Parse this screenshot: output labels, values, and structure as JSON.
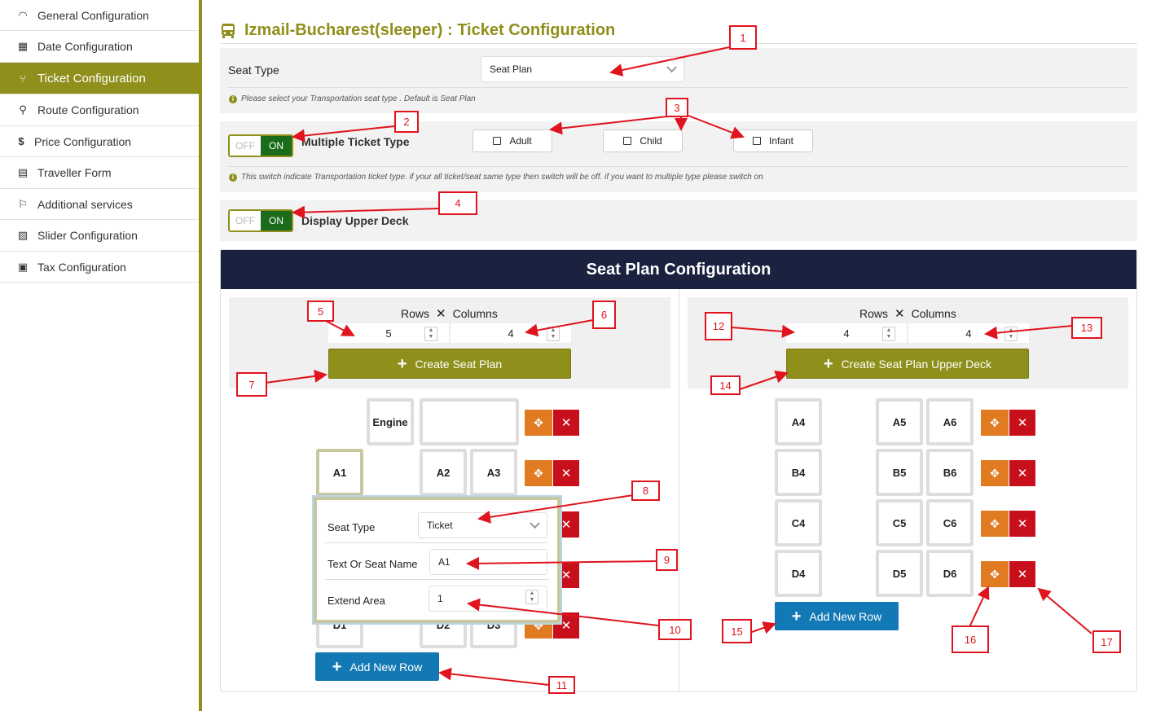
{
  "sidebar": {
    "items": [
      {
        "label": "General Configuration",
        "icon": "rainbow-icon"
      },
      {
        "label": "Date Configuration",
        "icon": "calendar-icon"
      },
      {
        "label": "Ticket Configuration",
        "icon": "seat-icon",
        "active": true
      },
      {
        "label": "Route Configuration",
        "icon": "route-icon"
      },
      {
        "label": "Price Configuration",
        "icon": "dollar-icon"
      },
      {
        "label": "Traveller Form",
        "icon": "form-icon"
      },
      {
        "label": "Additional services",
        "icon": "hand-service-icon"
      },
      {
        "label": "Slider Configuration",
        "icon": "images-icon"
      },
      {
        "label": "Tax Configuration",
        "icon": "money-icon"
      }
    ]
  },
  "header": {
    "title": "Izmail-Bucharest(sleeper) : Ticket Configuration"
  },
  "seat_type": {
    "label": "Seat Type",
    "value": "Seat Plan",
    "hint": "Please select your Transportation seat type . Default is Seat Plan"
  },
  "multiple_ticket": {
    "off": "OFF",
    "on": "ON",
    "label": "Multiple Ticket Type",
    "options": [
      "Adult",
      "Child",
      "Infant"
    ],
    "hint": "This switch indicate Transportation ticket type. if your all ticket/seat same type then switch will be off. if you want to multiple type please switch on"
  },
  "upper_deck": {
    "off": "OFF",
    "on": "ON",
    "label": "Display Upper Deck"
  },
  "seat_plan": {
    "title": "Seat Plan Configuration",
    "lower": {
      "rows_label": "Rows",
      "times": "✕",
      "cols_label": "Columns",
      "rows": "5",
      "cols": "4",
      "create_btn": "Create Seat Plan",
      "seats": [
        "Engine",
        "A1",
        "A2",
        "A3",
        "D1",
        "D2",
        "D3"
      ],
      "add_row": "Add New Row"
    },
    "upper": {
      "rows_label": "Rows",
      "times": "✕",
      "cols_label": "Columns",
      "rows": "4",
      "cols": "4",
      "create_btn": "Create Seat Plan Upper Deck",
      "seats": [
        "A4",
        "A5",
        "A6",
        "B4",
        "B5",
        "B6",
        "C4",
        "C5",
        "C6",
        "D4",
        "D5",
        "D6"
      ],
      "add_row": "Add New Row"
    }
  },
  "seat_popup": {
    "seat_type_label": "Seat Type",
    "seat_type_value": "Ticket",
    "name_label": "Text Or Seat Name",
    "name_value": "A1",
    "extend_label": "Extend Area",
    "extend_value": "1"
  },
  "markers": [
    "1",
    "2",
    "3",
    "4",
    "5",
    "6",
    "7",
    "8",
    "9",
    "10",
    "11",
    "12",
    "13",
    "14",
    "15",
    "16",
    "17"
  ],
  "colors": {
    "accent": "#8f8f1c",
    "header": "#1a2240",
    "blue": "#1379b5",
    "orange": "#e07b22",
    "red": "#c8101c",
    "annotation": "#e0141e"
  }
}
